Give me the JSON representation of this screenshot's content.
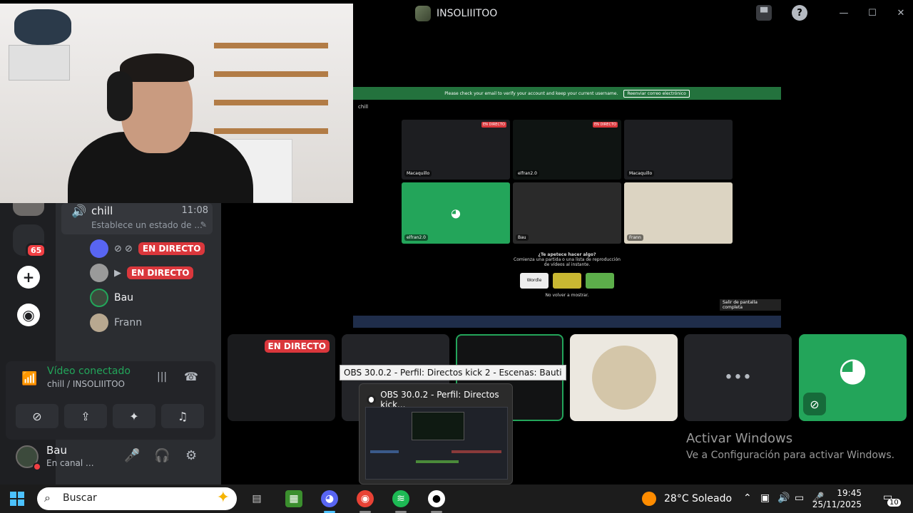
{
  "window": {
    "server_title": "INSOLIIITOO",
    "controls": {
      "minimize": "—",
      "maximize": "☐",
      "close": "✕",
      "help": "?"
    }
  },
  "sidebar": {
    "unread_badge": "65",
    "voice_channel": {
      "name": "chill",
      "time": "11:08",
      "status_placeholder": "Establece un estado de ..."
    },
    "members": [
      {
        "name": "",
        "live": "EN DIRECTO"
      },
      {
        "name": "",
        "live": "EN DIRECTO"
      },
      {
        "name": "Bau",
        "live": ""
      },
      {
        "name": "Frann",
        "live": ""
      }
    ],
    "voice_panel": {
      "title": "Vídeo conectado",
      "subtitle": "chill / INSOLIIITOO"
    },
    "user": {
      "name": "Bau",
      "status": "En canal ..."
    }
  },
  "stage": {
    "verify_text": "Please check your email to verify your account and keep your current username.",
    "verify_button": "Reenviar correo electrónico",
    "channel_label": "chill",
    "tiles": [
      {
        "label": "Macaquillo",
        "live": "EN DIRECTO"
      },
      {
        "label": "elfran2.0",
        "live": "EN DIRECTO"
      },
      {
        "label": "Macaquillo",
        "live": ""
      },
      {
        "label": "elfran2.0",
        "live": ""
      },
      {
        "label": "Bau",
        "live": ""
      },
      {
        "label": "Frann",
        "live": ""
      }
    ],
    "popup": {
      "title": "¿Te apetece hacer algo?",
      "subtitle": "Comienza una partida o una lista de reproducción de vídeos al instante.",
      "dont_show": "No volver a mostrar.",
      "game1": "Wordle"
    },
    "fullscreen_tooltip": "Salir de pantalla completa"
  },
  "strip": {
    "live_label": "EN DIRECTO"
  },
  "obs": {
    "tooltip": "OBS 30.0.2 - Perfil: Directos kick 2 - Escenas: Bauti",
    "preview_title": "OBS 30.0.2 - Perfil: Directos kick..."
  },
  "watermark": {
    "title": "Activar Windows",
    "subtitle": "Ve a Configuración para activar Windows."
  },
  "taskbar": {
    "search_placeholder": "Buscar",
    "weather": "28°C  Soleado",
    "time": "19:45",
    "date": "25/11/2025",
    "notif_count": "10"
  }
}
